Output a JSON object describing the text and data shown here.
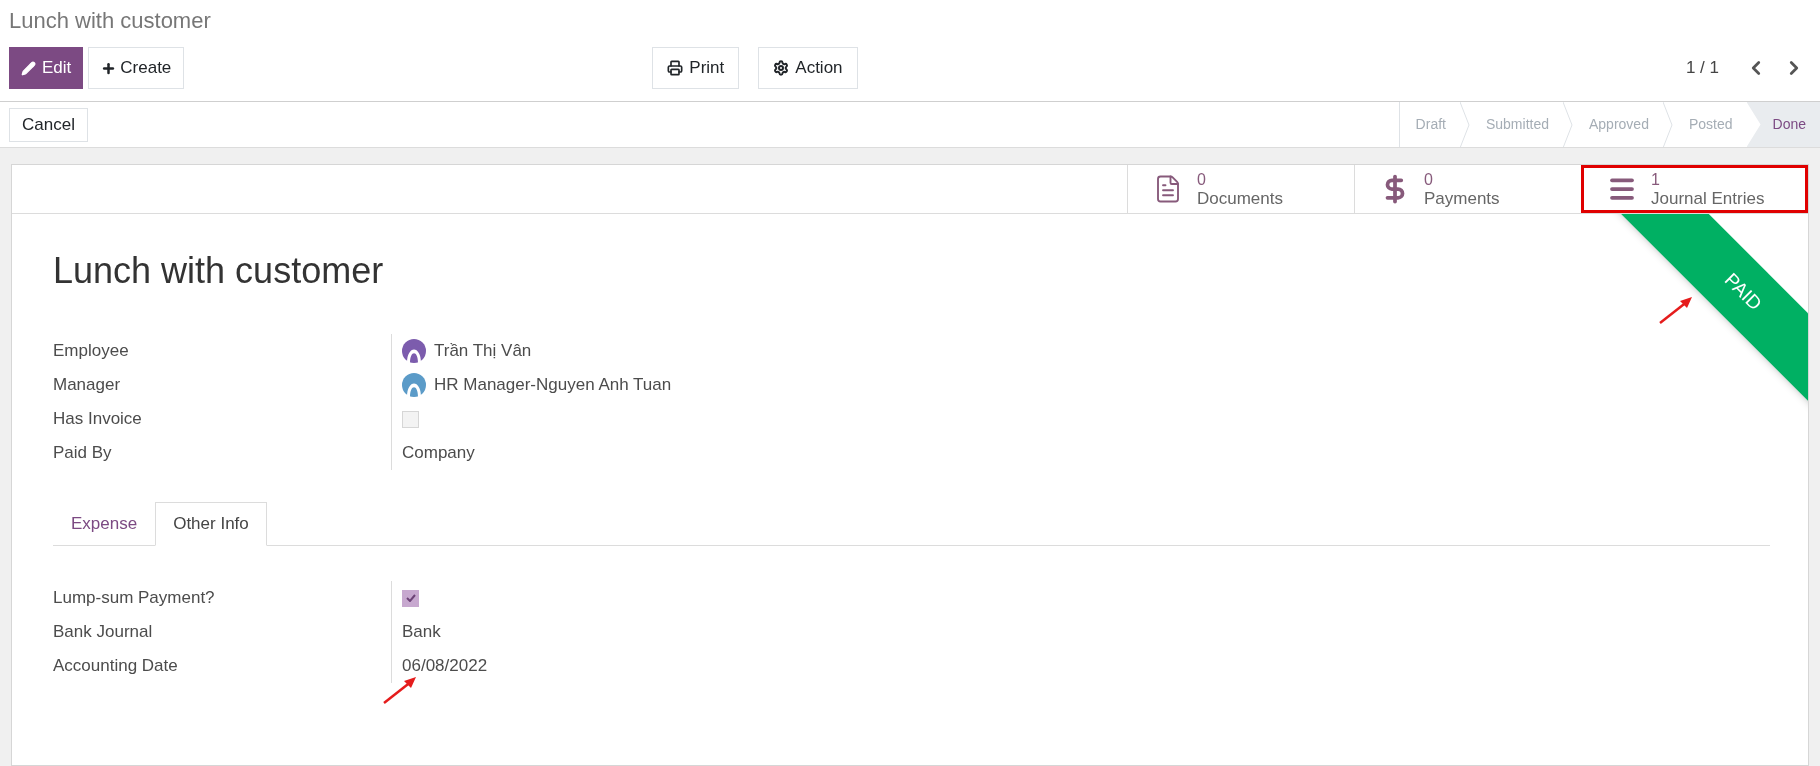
{
  "breadcrumb": "Lunch with customer",
  "toolbar": {
    "edit": "Edit",
    "create": "Create",
    "print": "Print",
    "action": "Action",
    "pager": "1 / 1"
  },
  "cancel": "Cancel",
  "statusbar": [
    {
      "label": "Draft",
      "selected": false
    },
    {
      "label": "Submitted",
      "selected": false
    },
    {
      "label": "Approved",
      "selected": false
    },
    {
      "label": "Posted",
      "selected": false
    },
    {
      "label": "Done",
      "selected": true
    }
  ],
  "stat_buttons": [
    {
      "kind": "document",
      "count": "0",
      "label": "Documents",
      "highlighted": false
    },
    {
      "kind": "dollar",
      "count": "0",
      "label": "Payments",
      "highlighted": false
    },
    {
      "kind": "list",
      "count": "1",
      "label": "Journal Entries",
      "highlighted": true
    }
  ],
  "ribbon": "PAID",
  "title": "Lunch with customer",
  "fields": [
    {
      "kind": "avatar",
      "label": "Employee",
      "value": "Trần Thị Vân",
      "color": "#7c5cad"
    },
    {
      "kind": "avatar",
      "label": "Manager",
      "value": "HR Manager-Nguyen Anh Tuan",
      "color": "#5b9bc8"
    },
    {
      "kind": "checkbox",
      "label": "Has Invoice",
      "checked": false
    },
    {
      "kind": "text",
      "label": "Paid By",
      "value": "Company"
    }
  ],
  "tabs": [
    {
      "label": "Expense",
      "selected": false
    },
    {
      "label": "Other Info",
      "selected": true
    }
  ],
  "other_info": [
    {
      "kind": "checkbox",
      "label": "Lump-sum Payment?",
      "checked": true
    },
    {
      "kind": "text",
      "label": "Bank Journal",
      "value": "Bank"
    },
    {
      "kind": "text",
      "label": "Accounting Date",
      "value": "06/08/2022",
      "annotated": true
    }
  ]
}
